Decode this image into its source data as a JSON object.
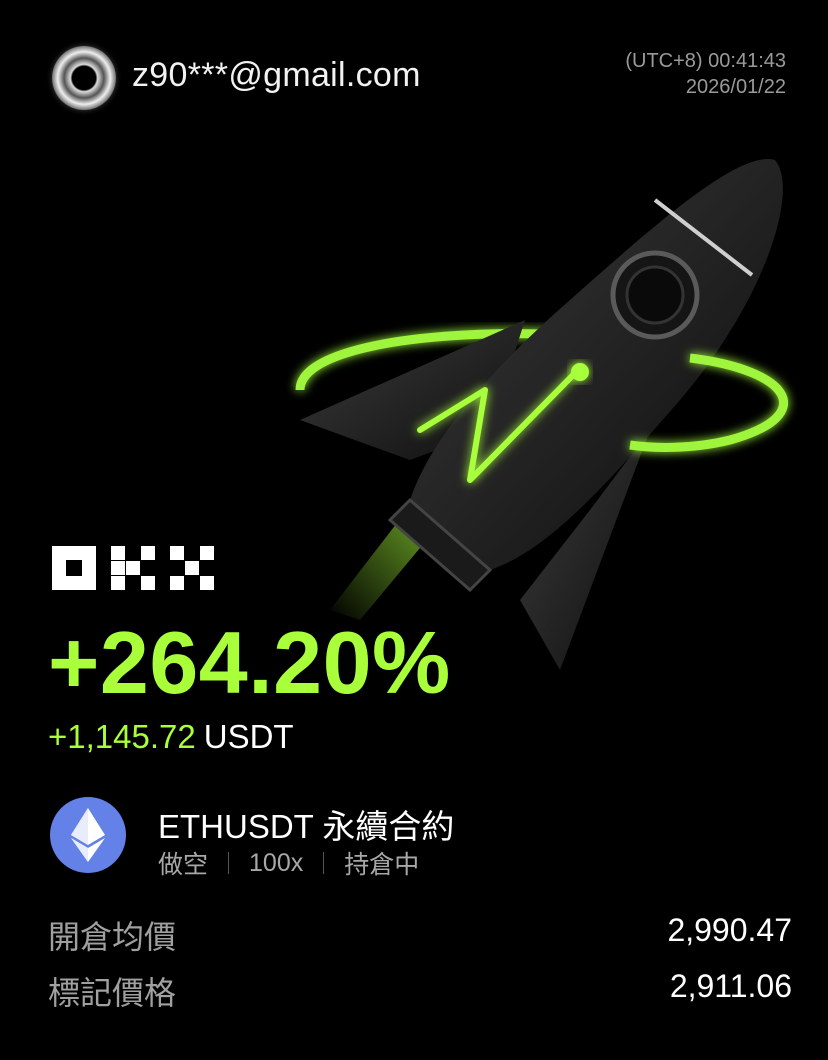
{
  "header": {
    "email": "z90***@gmail.com",
    "time": "(UTC+8) 00:41:43",
    "date": "2026/01/22"
  },
  "brand": {
    "logo_text": "OKX",
    "accent_color": "#a8ff3a"
  },
  "result": {
    "pnl_percent": "+264.20%",
    "pnl_amount": "+1,145.72",
    "pnl_unit": "USDT"
  },
  "contract": {
    "icon": "ethereum-icon",
    "pair": "ETHUSDT 永續合約",
    "tags": [
      "做空",
      "100x",
      "持倉中"
    ]
  },
  "details": [
    {
      "label": "開倉均價",
      "value": "2,990.47"
    },
    {
      "label": "標記價格",
      "value": "2,911.06"
    }
  ]
}
